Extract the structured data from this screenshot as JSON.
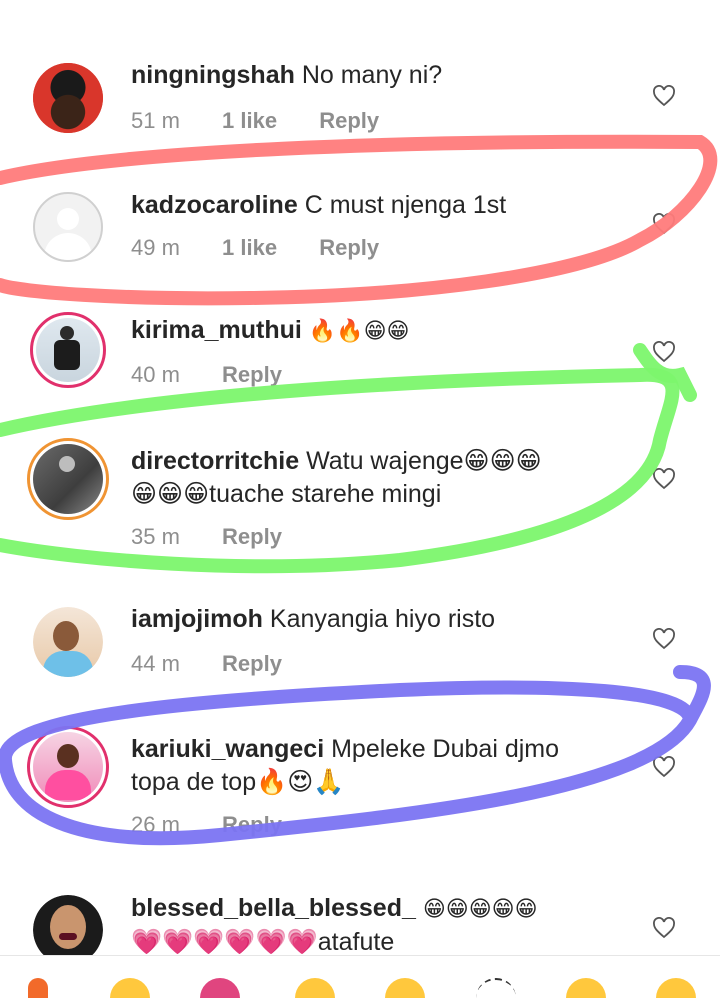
{
  "comments": [
    {
      "user": "ningningshah",
      "text": "No many ni?",
      "time": "51 m",
      "likes": "1 like",
      "reply": "Reply"
    },
    {
      "user": "kadzocaroline",
      "text": "C must njenga 1st",
      "time": "49 m",
      "likes": "1 like",
      "reply": "Reply"
    },
    {
      "user": "kirima_muthui",
      "text": "🔥🔥😁😁",
      "time": "40 m",
      "reply": "Reply"
    },
    {
      "user": "directorritchie",
      "text": "Watu wajenge😁😁😁",
      "text2": "😁😁😁tuache starehe mingi",
      "time": "35 m",
      "reply": "Reply"
    },
    {
      "user": "iamjojimoh",
      "text": "Kanyangia hiyo risto",
      "time": "44 m",
      "reply": "Reply"
    },
    {
      "user": "kariuki_wangeci",
      "text": "Mpeleke Dubai djmo",
      "text2": "topa de top🔥😍🙏",
      "time": "26 m",
      "reply": "Reply"
    },
    {
      "user": "blessed_bella_blessed_",
      "text": "😁😁😁😁😁",
      "text2": "💗💗💗💗💗💗atafute"
    }
  ],
  "colors": {
    "annotation_red": "#ff7b7b",
    "annotation_green": "#7cf56d",
    "annotation_blue": "#7b74f2",
    "story_ring": "#e1306c",
    "meta_gray": "#8e8e8e"
  },
  "icons": {
    "like": "heart-outline-icon"
  }
}
